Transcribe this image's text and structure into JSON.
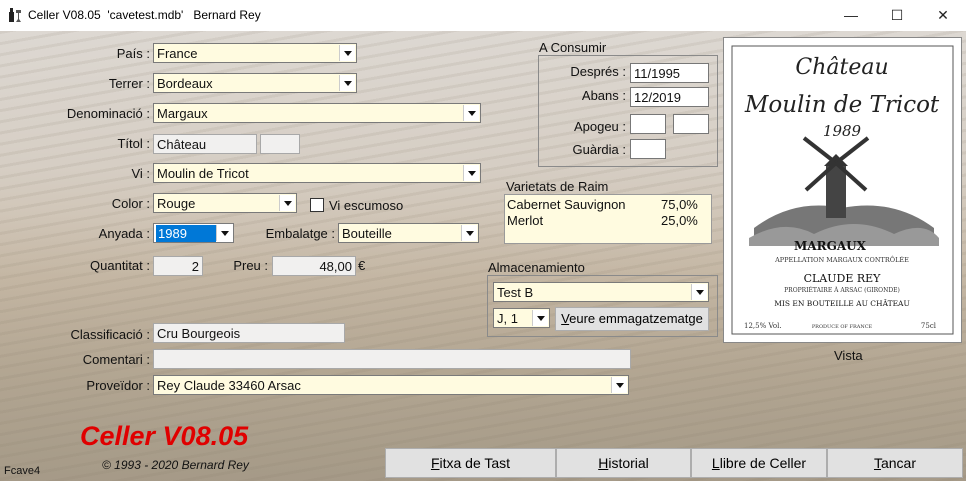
{
  "window": {
    "title": "Celler V08.05  'cavetest.mdb'   Bernard Rey",
    "minimize": "—",
    "maximize": "☐",
    "close": "✕"
  },
  "form": {
    "pais": {
      "label": "País :",
      "value": "France"
    },
    "terrer": {
      "label": "Terrer :",
      "value": "Bordeaux"
    },
    "denominacio": {
      "label": "Denominació :",
      "value": "Margaux"
    },
    "titol": {
      "label": "Títol :",
      "value": "Château",
      "value2": ""
    },
    "vi": {
      "label": "Vi :",
      "value": "Moulin de Tricot"
    },
    "color": {
      "label": "Color :",
      "value": "Rouge"
    },
    "vi_escumoso": {
      "label": "Vi escumoso",
      "checked": false
    },
    "anyada": {
      "label": "Anyada :",
      "value": "1989"
    },
    "embalatge": {
      "label": "Embalatge :",
      "value": "Bouteille"
    },
    "quantitat": {
      "label": "Quantitat :",
      "value": "2"
    },
    "preu": {
      "label": "Preu :",
      "value": "48,00",
      "currency": "€"
    },
    "classificacio": {
      "label": "Classificació :",
      "value": "Cru Bourgeois"
    },
    "comentari": {
      "label": "Comentari :",
      "value": ""
    },
    "proveidor": {
      "label": "Proveïdor :",
      "value": "Rey Claude 33460 Arsac"
    }
  },
  "a_consumir": {
    "title": "A Consumir",
    "despres": {
      "label": "Després :",
      "value": "11/1995"
    },
    "abans": {
      "label": "Abans :",
      "value": "12/2019"
    },
    "apogeu": {
      "label": "Apogeu :",
      "value1": "",
      "value2": ""
    },
    "guardia": {
      "label": "Guàrdia :",
      "value": ""
    }
  },
  "varietats": {
    "title": "Varietats de Raim",
    "items": [
      {
        "name": "Cabernet Sauvignon",
        "pct": "75,0%"
      },
      {
        "name": "Merlot",
        "pct": "25,0%"
      }
    ]
  },
  "almacenamiento": {
    "title": "Almacenamiento",
    "location": "Test B",
    "position": "J, 1",
    "button": "Veure emmagatzematge",
    "button_mnemonic": "V"
  },
  "wine_label": {
    "line1": "Château",
    "line2": "Moulin de Tricot",
    "vintage": "1989",
    "appellation": "MARGAUX",
    "appellation_sub": "APPELLATION MARGAUX CONTRÔLÉE",
    "owner": "CLAUDE REY",
    "owner_sub": "PROPRIÉTAIRE À ARSAC (GIRONDE)",
    "bottled": "MIS EN BOUTEILLE AU CHÂTEAU",
    "volume": "12,5% Vol.",
    "origin": "PRODUCE OF FRANCE",
    "size": "75cl",
    "caption": "Vista"
  },
  "branding": {
    "name": "Celler V08.05",
    "copyright": "© 1993 - 2020 Bernard Rey",
    "form_id": "Fcave4"
  },
  "buttons": {
    "fitxa": {
      "label": "Fitxa de Tast",
      "mnemonic": "F"
    },
    "historial": {
      "label": "Historial",
      "mnemonic": "H"
    },
    "llibre": {
      "label": "Llibre de Celler",
      "mnemonic": "L"
    },
    "tancar": {
      "label": "Tancar",
      "mnemonic": "T"
    }
  },
  "colors": {
    "field_bg": "#fffbe0",
    "selection": "#0078d7",
    "brand_red": "#e00000"
  }
}
